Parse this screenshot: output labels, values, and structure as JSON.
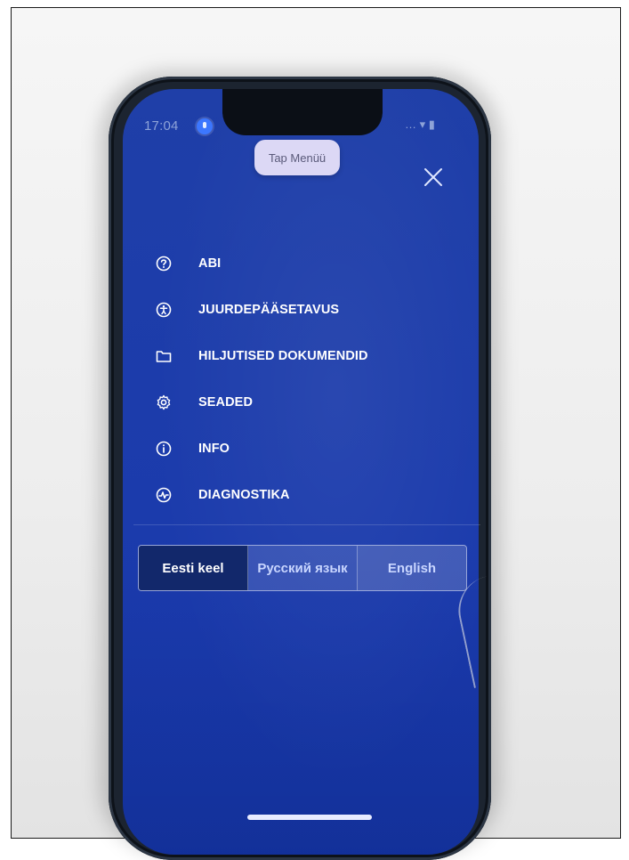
{
  "status_bar": {
    "time": "17:04",
    "icons": "… ▾ ▮"
  },
  "tap_menu_label": "Tap Menüü",
  "menu": {
    "items": [
      {
        "label": "ABI",
        "icon": "help-icon"
      },
      {
        "label": "JUURDEPÄÄSETAVUS",
        "icon": "accessibility-icon"
      },
      {
        "label": "HILJUTISED DOKUMENDID",
        "icon": "folder-icon"
      },
      {
        "label": "SEADED",
        "icon": "gear-icon"
      },
      {
        "label": "INFO",
        "icon": "info-icon"
      },
      {
        "label": "DIAGNOSTIKA",
        "icon": "diagnostics-icon"
      }
    ]
  },
  "languages": [
    {
      "label": "Eesti keel",
      "active": true
    },
    {
      "label": "Русский язык",
      "active": false
    },
    {
      "label": "English",
      "active": false
    }
  ],
  "colors": {
    "screen_bg": "#1c3cab",
    "active_lang_bg": "#12286b",
    "tap_menu_bg": "#dcd8f5"
  }
}
